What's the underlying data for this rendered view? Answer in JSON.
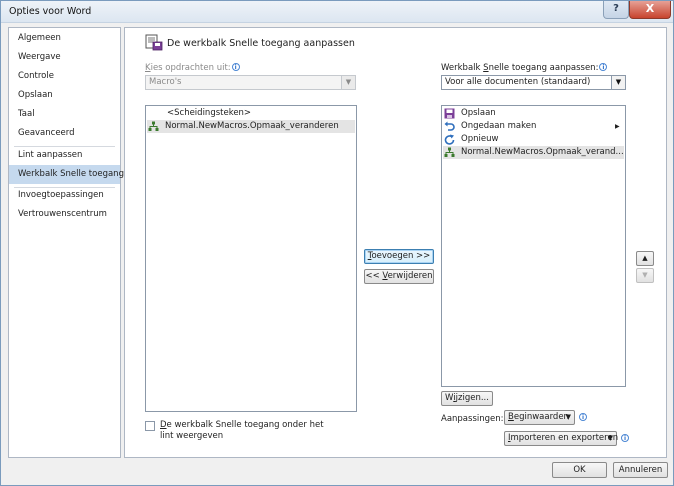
{
  "window": {
    "title": "Opties voor Word",
    "help_label": "?",
    "close_label": "X"
  },
  "sidebar": {
    "items": [
      {
        "label": "Algemeen"
      },
      {
        "label": "Weergave"
      },
      {
        "label": "Controle"
      },
      {
        "label": "Opslaan"
      },
      {
        "label": "Taal"
      },
      {
        "label": "Geavanceerd"
      },
      {
        "label": "Lint aanpassen"
      },
      {
        "label": "Werkbalk Snelle toegang"
      },
      {
        "label": "Invoegtoepassingen"
      },
      {
        "label": "Vertrouwenscentrum"
      }
    ]
  },
  "main": {
    "section_title": "De werkbalk Snelle toegang aanpassen",
    "left": {
      "label_prefix": "K",
      "label_rest": "ies opdrachten uit:",
      "combo_value": "Macro's",
      "items": [
        {
          "label": "<Scheidingsteken>",
          "icon": "separator"
        },
        {
          "label": "Normal.NewMacros.Opmaak_veranderen",
          "icon": "macro-icon"
        }
      ]
    },
    "right": {
      "label_prefix": "Werkbalk ",
      "label_u": "S",
      "label_rest": "nelle toegang aanpassen:",
      "combo_value": "Voor alle documenten (standaard)",
      "items": [
        {
          "label": "Opslaan",
          "icon": "save-icon"
        },
        {
          "label": "Ongedaan maken",
          "icon": "undo-icon"
        },
        {
          "label": "Opnieuw",
          "icon": "redo-icon"
        },
        {
          "label": "Normal.NewMacros.Opmaak_verand...",
          "icon": "macro-icon"
        }
      ]
    },
    "add_button": {
      "u": "T",
      "rest": "oevoegen >>"
    },
    "remove_button": {
      "prefix": "<< ",
      "u": "V",
      "rest": "erwijderen"
    },
    "modify_button": {
      "prefix": "W",
      "u": "i",
      "rest": "jzigen..."
    },
    "checkbox": {
      "u": "D",
      "rest": "e werkbalk Snelle toegang onder het lint weergeven",
      "checked": false
    },
    "customizations_label": "Aanpassingen:",
    "reset_button": {
      "u": "B",
      "rest": "eginwaarden"
    },
    "import_export_button": {
      "u": "I",
      "rest": "mporteren en exporteren"
    },
    "move_up_glyph": "▲",
    "move_down_glyph": "▼"
  },
  "footer": {
    "ok_label": "OK",
    "cancel_label": "Annuleren"
  },
  "colors": {
    "selected_nav": "#c5d9ee",
    "titlebar": "#dce6f1",
    "close_button": "#c8442e",
    "save_icon": "#7b3f98",
    "undo_icon": "#2f6fbd",
    "redo_icon": "#2f6fbd",
    "macro_icon": "#3b7a2e"
  }
}
